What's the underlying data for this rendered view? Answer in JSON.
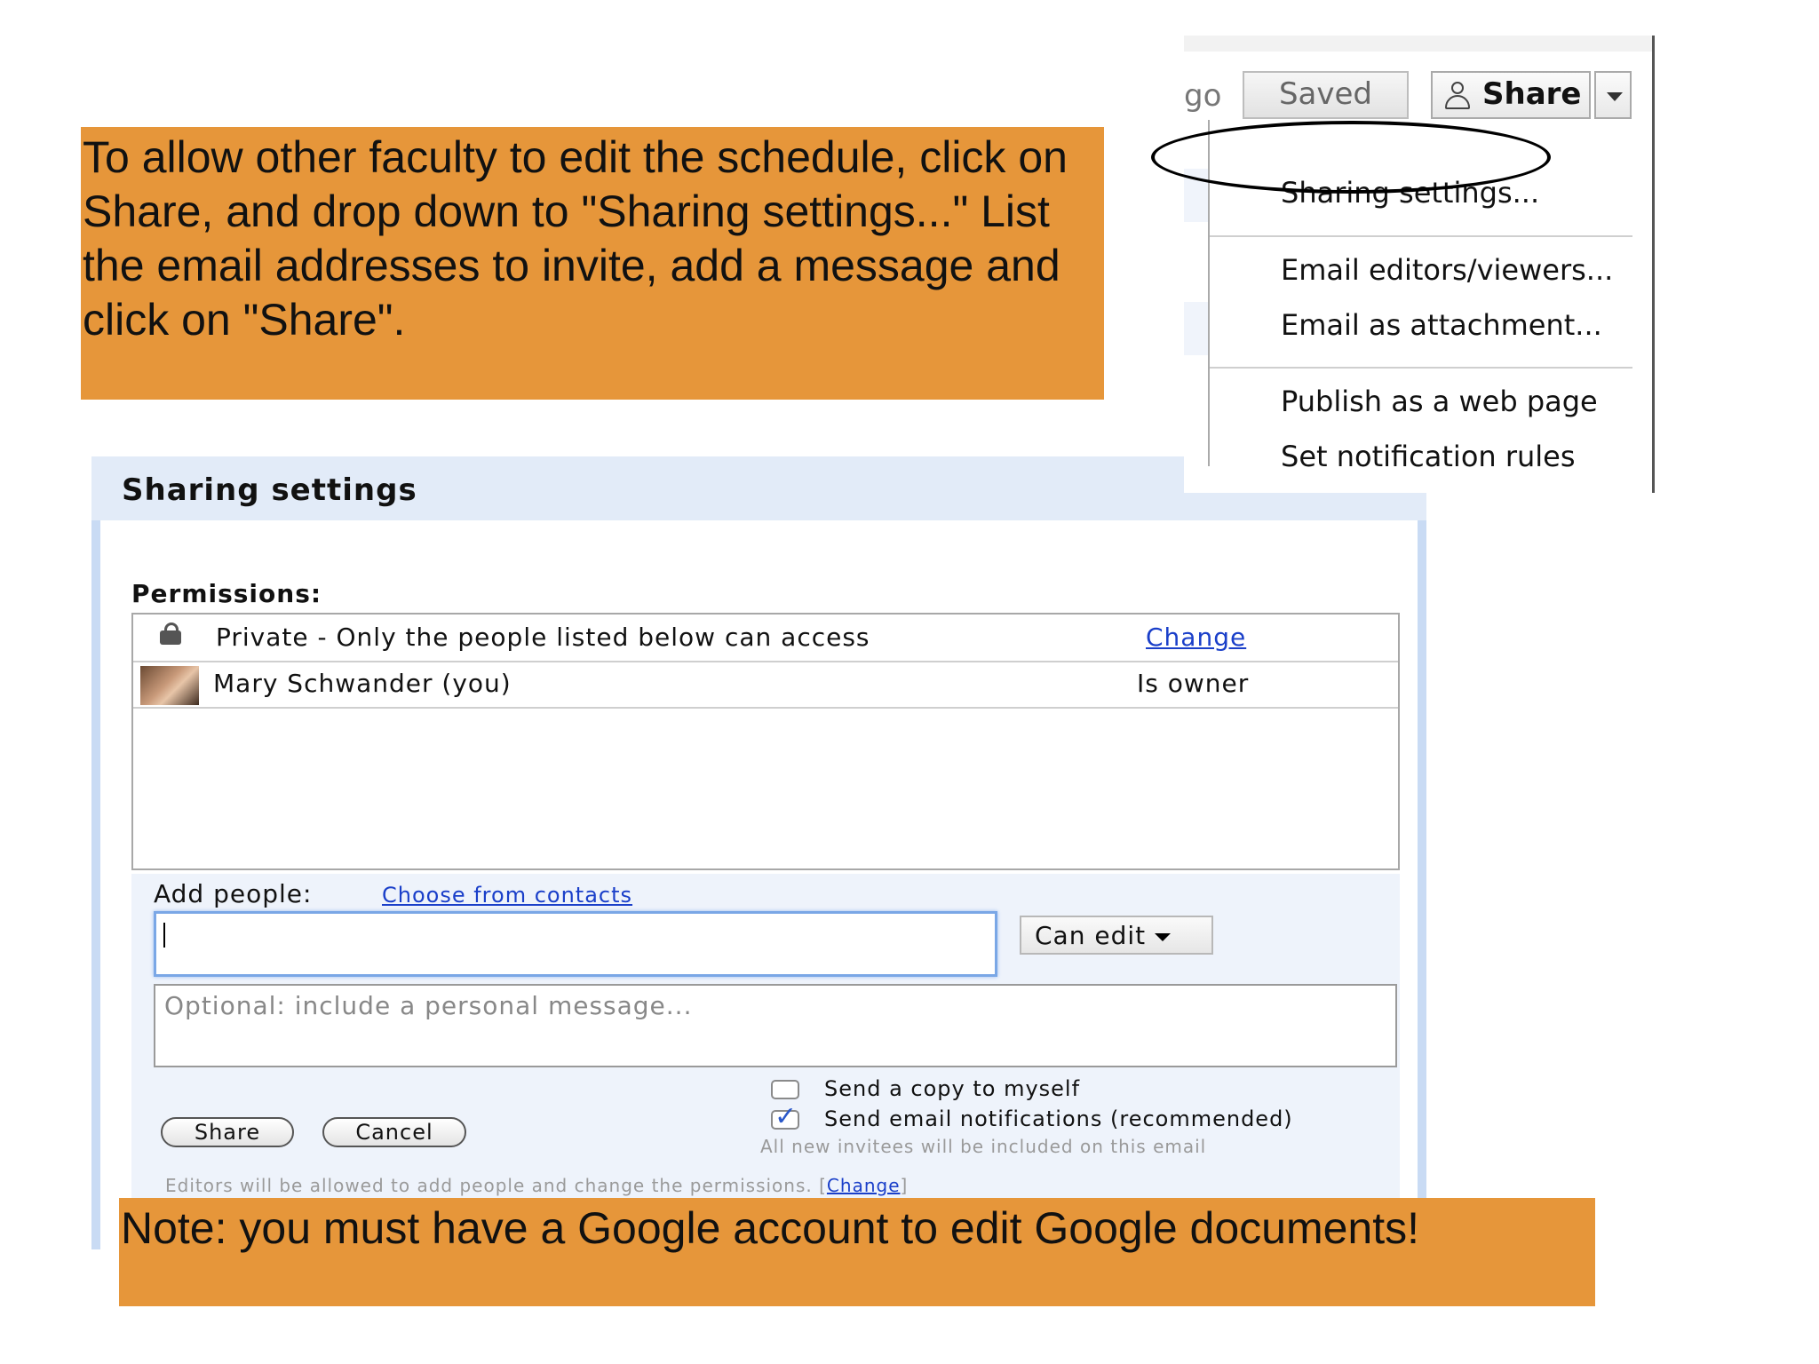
{
  "instructions": {
    "text": "To allow other faculty to edit the schedule, click on Share, and drop down to \"Sharing settings...\" List the email addresses to invite, add a message and click on \"Share\"."
  },
  "note": {
    "text": "Note: you  must have a Google account to edit Google documents!"
  },
  "menu": {
    "go_fragment": "go",
    "saved_label": "Saved",
    "share_label": "Share",
    "items": [
      "Sharing settings...",
      "Email editors/viewers...",
      "Email as attachment...",
      "Publish as a web page",
      "Set notification rules"
    ]
  },
  "dialog": {
    "title": "Sharing settings",
    "permissions_label": "Permissions:",
    "rows": [
      {
        "text": "Private - Only the people listed below can access",
        "action": "Change"
      },
      {
        "text": "Mary Schwander (you)",
        "role": "Is owner"
      }
    ],
    "add_people_label": "Add people:",
    "choose_contacts": "Choose from contacts",
    "add_input_value": "",
    "permission_select": "Can edit",
    "message_placeholder": "Optional: include a personal message...",
    "send_copy_label": "Send a copy to myself",
    "send_copy_checked": false,
    "send_notifications_label": "Send email notifications (recommended)",
    "send_notifications_checked": true,
    "invitees_note": "All new invitees will be included on this email",
    "share_button": "Share",
    "cancel_button": "Cancel",
    "editors_note": "Editors will be allowed to add people and change the permissions.",
    "editors_change": "Change"
  },
  "colors": {
    "note_background": "#E6963A",
    "dialog_frame": "#C9DBF4",
    "link": "#1a3fc9"
  }
}
